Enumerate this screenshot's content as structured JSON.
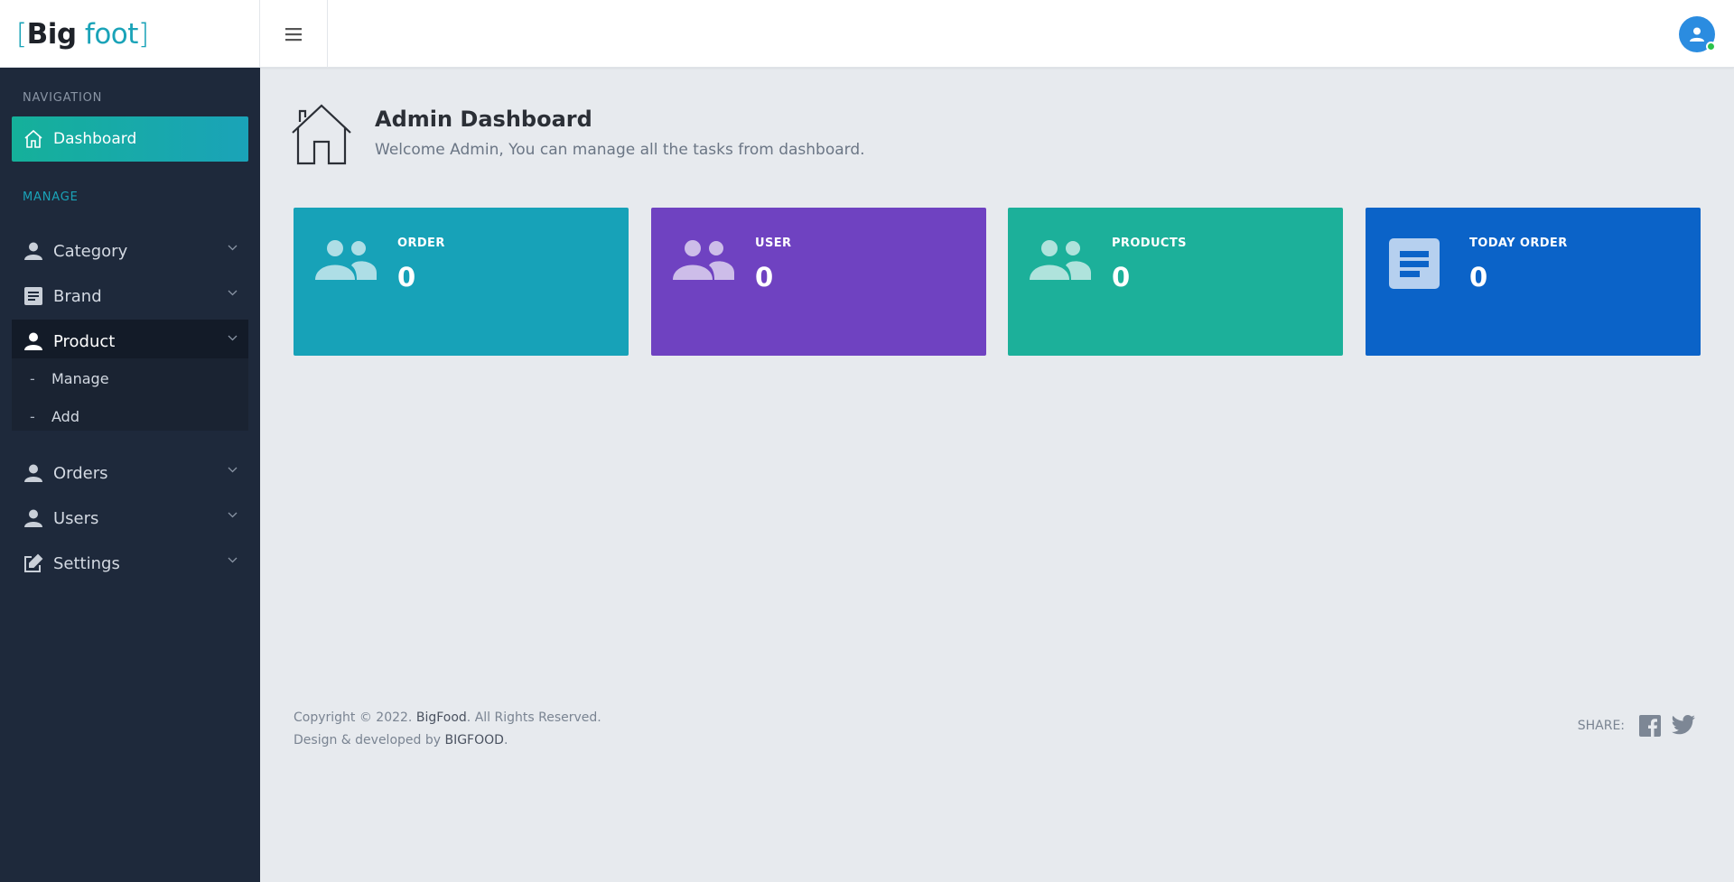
{
  "header": {
    "logo": {
      "bracket_open": "[",
      "big": "Big",
      "foot": "foot",
      "bracket_close": "]"
    }
  },
  "sidebar": {
    "navigation_label": "NAVIGATION",
    "manage_label": "MANAGE",
    "dashboard_label": "Dashboard",
    "items": [
      {
        "label": "Category",
        "icon": "user-icon"
      },
      {
        "label": "Brand",
        "icon": "document-icon"
      },
      {
        "label": "Product",
        "icon": "user-icon"
      },
      {
        "label": "Orders",
        "icon": "user-icon"
      },
      {
        "label": "Users",
        "icon": "user-icon"
      },
      {
        "label": "Settings",
        "icon": "edit-icon"
      }
    ],
    "product_submenu": [
      {
        "dash": "-",
        "label": "Manage"
      },
      {
        "dash": "-",
        "label": "Add"
      }
    ]
  },
  "main": {
    "title": "Admin Dashboard",
    "subtitle": "Welcome Admin, You can manage all the tasks from dashboard.",
    "cards": [
      {
        "label": "ORDER",
        "value": "0",
        "color": "#17a2b8",
        "icon": "users-icon"
      },
      {
        "label": "USER",
        "value": "0",
        "color": "#6f42c1",
        "icon": "users-icon"
      },
      {
        "label": "PRODUCTS",
        "value": "0",
        "color": "#1cb09a",
        "icon": "users-icon"
      },
      {
        "label": "TODAY ORDER",
        "value": "0",
        "color": "#0b63c8",
        "icon": "document-icon"
      }
    ]
  },
  "footer": {
    "copyright_prefix": "Copyright © 2022. ",
    "copyright_brand": "BigFood",
    "copyright_suffix": ". All Rights Reserved.",
    "design_prefix": "Design & developed by ",
    "design_brand": "BIGFOOD",
    "design_suffix": ".",
    "share_label": "SHARE:"
  },
  "colors": {
    "sidebar_bg": "#1e293b",
    "accent": "#1aa3b8",
    "page_bg": "#e7eaee"
  }
}
